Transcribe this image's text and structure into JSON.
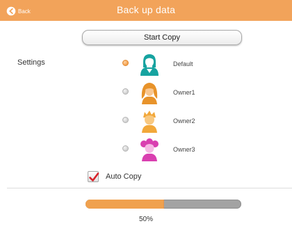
{
  "header": {
    "back_label": "Back",
    "title": "Back up data",
    "bg_color": "#f2a35a"
  },
  "actions": {
    "start_copy_label": "Start Copy"
  },
  "settings": {
    "label": "Settings",
    "profiles": [
      {
        "label": "Default",
        "selected": true,
        "color": "#16a3a0",
        "icon": "person-default-icon"
      },
      {
        "label": "Owner1",
        "selected": false,
        "color": "#e8932a",
        "icon": "person-owner1-icon"
      },
      {
        "label": "Owner2",
        "selected": false,
        "color": "#f2a83a",
        "icon": "person-owner2-icon"
      },
      {
        "label": "Owner3",
        "selected": false,
        "color": "#d93fb0",
        "icon": "person-owner3-icon"
      }
    ]
  },
  "auto_copy": {
    "label": "Auto Copy",
    "checked": true
  },
  "progress": {
    "percent": 50,
    "text": "50%",
    "fill_color": "#f0a14e",
    "track_color": "#a3a3a3"
  }
}
